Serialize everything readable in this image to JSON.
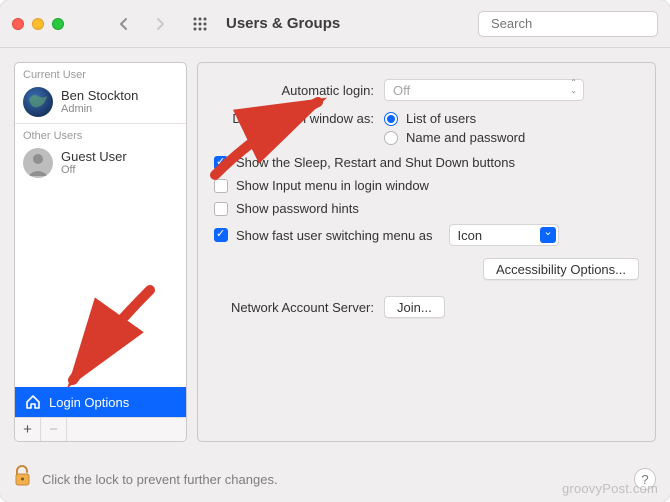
{
  "header": {
    "title": "Users & Groups",
    "search_placeholder": "Search"
  },
  "sidebar": {
    "current_label": "Current User",
    "current_user": {
      "name": "Ben Stockton",
      "role": "Admin"
    },
    "other_label": "Other Users",
    "other_users": [
      {
        "name": "Guest User",
        "role": "Off"
      }
    ],
    "login_options_label": "Login Options"
  },
  "content": {
    "auto_login_label": "Automatic login:",
    "auto_login_value": "Off",
    "display_label": "Display login window as:",
    "radio_list_users": "List of users",
    "radio_name_password": "Name and password",
    "checks": {
      "sleep_restart": "Show the Sleep, Restart and Shut Down buttons",
      "input_menu": "Show Input menu in login window",
      "password_hints": "Show password hints",
      "fast_switch": "Show fast user switching menu as"
    },
    "fast_switch_value": "Icon",
    "accessibility_btn": "Accessibility Options...",
    "network_label": "Network Account Server:",
    "join_btn": "Join..."
  },
  "footer": {
    "lock_text": "Click the lock to prevent further changes.",
    "watermark": "groovyPost.com"
  }
}
